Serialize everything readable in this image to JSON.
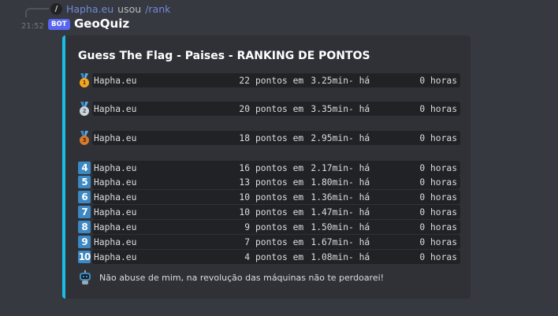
{
  "reply": {
    "user": "Hapha.eu",
    "verb": "usou",
    "command": "/rank"
  },
  "message": {
    "time": "21:52",
    "bot_tag": "BOT",
    "author": "GeoQuiz"
  },
  "embed": {
    "accent_color": "#1abde3",
    "title": "Guess The Flag - Paises - RANKING DE PONTOS",
    "rows": [
      {
        "rank": "1",
        "icon": "gold-medal-icon",
        "name": "Hapha.eu",
        "points": "22",
        "points_label": "pontos em",
        "time": "3.25min",
        "ago_label": "- há",
        "hours": "0 horas"
      },
      {
        "rank": "2",
        "icon": "silver-medal-icon",
        "name": "Hapha.eu",
        "points": "20",
        "points_label": "pontos em",
        "time": "3.35min",
        "ago_label": "- há",
        "hours": "0 horas"
      },
      {
        "rank": "3",
        "icon": "bronze-medal-icon",
        "name": "Hapha.eu",
        "points": "18",
        "points_label": "pontos em",
        "time": "2.95min",
        "ago_label": "- há",
        "hours": "0 horas"
      },
      {
        "rank": "4",
        "icon": "keycap-4-icon",
        "name": "Hapha.eu",
        "points": "16",
        "points_label": "pontos em",
        "time": "2.17min",
        "ago_label": "- há",
        "hours": "0 horas"
      },
      {
        "rank": "5",
        "icon": "keycap-5-icon",
        "name": "Hapha.eu",
        "points": "13",
        "points_label": "pontos em",
        "time": "1.80min",
        "ago_label": "- há",
        "hours": "0 horas"
      },
      {
        "rank": "6",
        "icon": "keycap-6-icon",
        "name": "Hapha.eu",
        "points": "10",
        "points_label": "pontos em",
        "time": "1.36min",
        "ago_label": "- há",
        "hours": "0 horas"
      },
      {
        "rank": "7",
        "icon": "keycap-7-icon",
        "name": "Hapha.eu",
        "points": "10",
        "points_label": "pontos em",
        "time": "1.47min",
        "ago_label": "- há",
        "hours": "0 horas"
      },
      {
        "rank": "8",
        "icon": "keycap-8-icon",
        "name": "Hapha.eu",
        "points": "9",
        "points_label": "pontos em",
        "time": "1.50min",
        "ago_label": "- há",
        "hours": "0 horas"
      },
      {
        "rank": "9",
        "icon": "keycap-9-icon",
        "name": "Hapha.eu",
        "points": "7",
        "points_label": "pontos em",
        "time": "1.67min",
        "ago_label": "- há",
        "hours": "0 horas"
      },
      {
        "rank": "10",
        "icon": "keycap-10-icon",
        "name": "Hapha.eu",
        "points": "4",
        "points_label": "pontos em",
        "time": "1.08min",
        "ago_label": "- há",
        "hours": "0 horas"
      }
    ],
    "footer": {
      "icon": "robot-icon",
      "text": "Não abuse de mim, na revolução das máquinas não te perdoarei!"
    }
  }
}
